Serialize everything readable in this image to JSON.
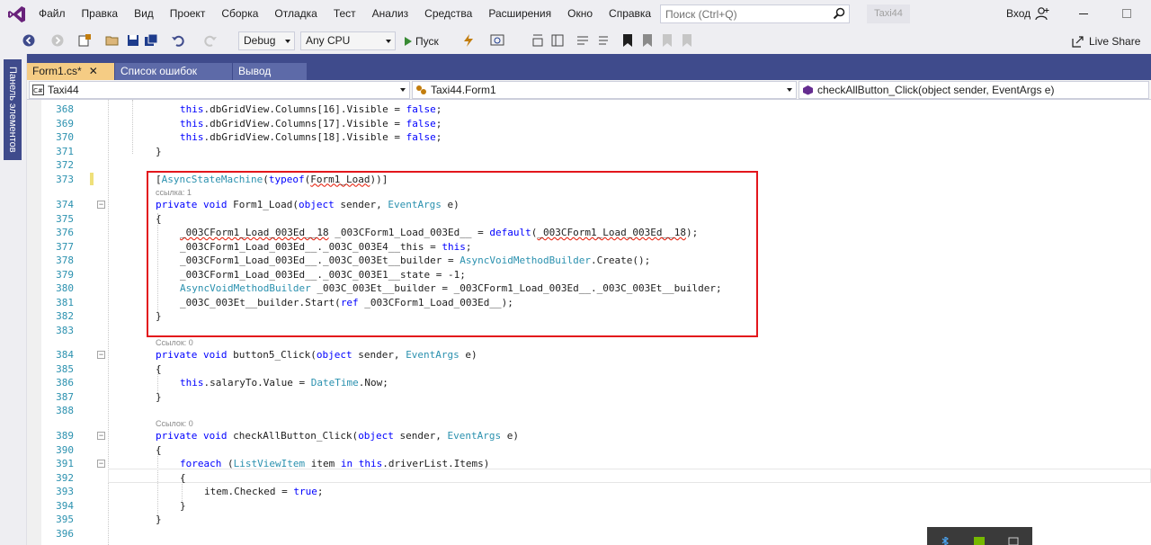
{
  "menu": {
    "items": [
      "Файл",
      "Правка",
      "Вид",
      "Проект",
      "Сборка",
      "Отладка",
      "Тест",
      "Анализ",
      "Средства",
      "Расширения",
      "Окно",
      "Справка"
    ],
    "search_placeholder": "Поиск (Ctrl+Q)",
    "solution_name": "Taxi44",
    "login": "Вход"
  },
  "toolbar": {
    "configuration": "Debug",
    "platform": "Any CPU",
    "run_label": "Пуск",
    "live_share": "Live Share"
  },
  "side_panel": {
    "label": "Панель элементов"
  },
  "tabs": [
    {
      "label": "Form1.cs*",
      "active": true
    },
    {
      "label": "Список ошибок",
      "active": false
    },
    {
      "label": "Вывод",
      "active": false
    }
  ],
  "nav": {
    "project": "Taxi44",
    "class": "Taxi44.Form1",
    "member": "checkAllButton_Click(object sender, EventArgs e)"
  },
  "code_lines": [
    {
      "num": "368",
      "text": "this.dbGridView.Columns[16].Visible = false;"
    },
    {
      "num": "369",
      "text": "this.dbGridView.Columns[17].Visible = false;"
    },
    {
      "num": "370",
      "text": "this.dbGridView.Columns[18].Visible = false;"
    },
    {
      "num": "371",
      "text": "}"
    },
    {
      "num": "372",
      "text": ""
    },
    {
      "num": "373",
      "text": "[AsyncStateMachine(typeof(Form1_Load))]"
    },
    {
      "lens": "ссылка: 1"
    },
    {
      "num": "374",
      "text": "private void Form1_Load(object sender, EventArgs e)"
    },
    {
      "num": "375",
      "text": "{"
    },
    {
      "num": "376",
      "text": "_003CForm1_Load_003Ed__18 _003CForm1_Load_003Ed__ = default(_003CForm1_Load_003Ed__18);"
    },
    {
      "num": "377",
      "text": "_003CForm1_Load_003Ed__._003C_003E4__this = this;"
    },
    {
      "num": "378",
      "text": "_003CForm1_Load_003Ed__._003C_003Et__builder = AsyncVoidMethodBuilder.Create();"
    },
    {
      "num": "379",
      "text": "_003CForm1_Load_003Ed__._003C_003E1__state = -1;"
    },
    {
      "num": "380",
      "text": "AsyncVoidMethodBuilder _003C_003Et__builder = _003CForm1_Load_003Ed__._003C_003Et__builder;"
    },
    {
      "num": "381",
      "text": "_003C_003Et__builder.Start(ref _003CForm1_Load_003Ed__);"
    },
    {
      "num": "382",
      "text": "}"
    },
    {
      "num": "383",
      "text": ""
    },
    {
      "lens": "Ссылок: 0"
    },
    {
      "num": "384",
      "text": "private void button5_Click(object sender, EventArgs e)"
    },
    {
      "num": "385",
      "text": "{"
    },
    {
      "num": "386",
      "text": "this.salaryTo.Value = DateTime.Now;"
    },
    {
      "num": "387",
      "text": "}"
    },
    {
      "num": "388",
      "text": ""
    },
    {
      "lens": "Ссылок: 0"
    },
    {
      "num": "389",
      "text": "private void checkAllButton_Click(object sender, EventArgs e)"
    },
    {
      "num": "390",
      "text": "{"
    },
    {
      "num": "391",
      "text": "foreach (ListViewItem item in this.driverList.Items)"
    },
    {
      "num": "392",
      "text": "{"
    },
    {
      "num": "393",
      "text": "item.Checked = true;"
    },
    {
      "num": "394",
      "text": "}"
    },
    {
      "num": "395",
      "text": "}"
    },
    {
      "num": "396",
      "text": ""
    }
  ],
  "colors": {
    "accent_tab": "#f5cc84",
    "tab_strip": "#3f4b8c",
    "keyword": "#0000ff",
    "type": "#2b91af",
    "highlight_border": "#e3161c"
  }
}
